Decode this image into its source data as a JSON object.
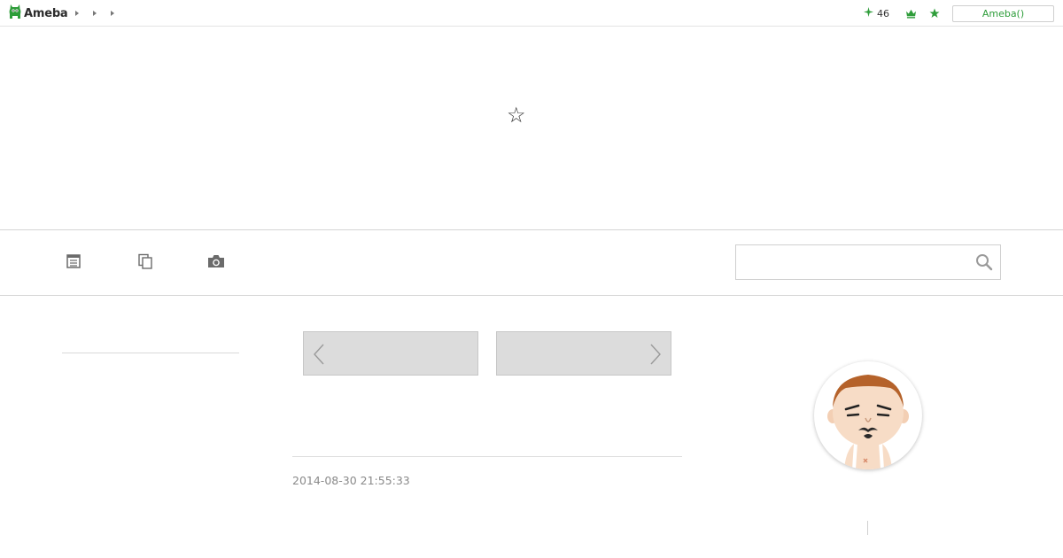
{
  "topbar": {
    "logo_label": "Ameba",
    "star_count": "46",
    "login_label": "Ameba()"
  },
  "header": {
    "blog_title": "☆"
  },
  "search": {
    "placeholder": "",
    "value": ""
  },
  "entry": {
    "date": "2014-08-30 21:55:33"
  },
  "colors": {
    "accent_green": "#2e9d3a",
    "pager_fill": "#dcdcdc",
    "divider": "#d4d4d4"
  },
  "icons": {
    "topbar": [
      "ameba-logo-icon",
      "chevron-right-icon",
      "sparkle-icon",
      "crown-icon",
      "star-icon"
    ],
    "nav": [
      "entry-list-icon",
      "archive-icon",
      "camera-icon",
      "search-icon"
    ],
    "pager": [
      "chevron-left-icon",
      "chevron-right-icon"
    ]
  }
}
